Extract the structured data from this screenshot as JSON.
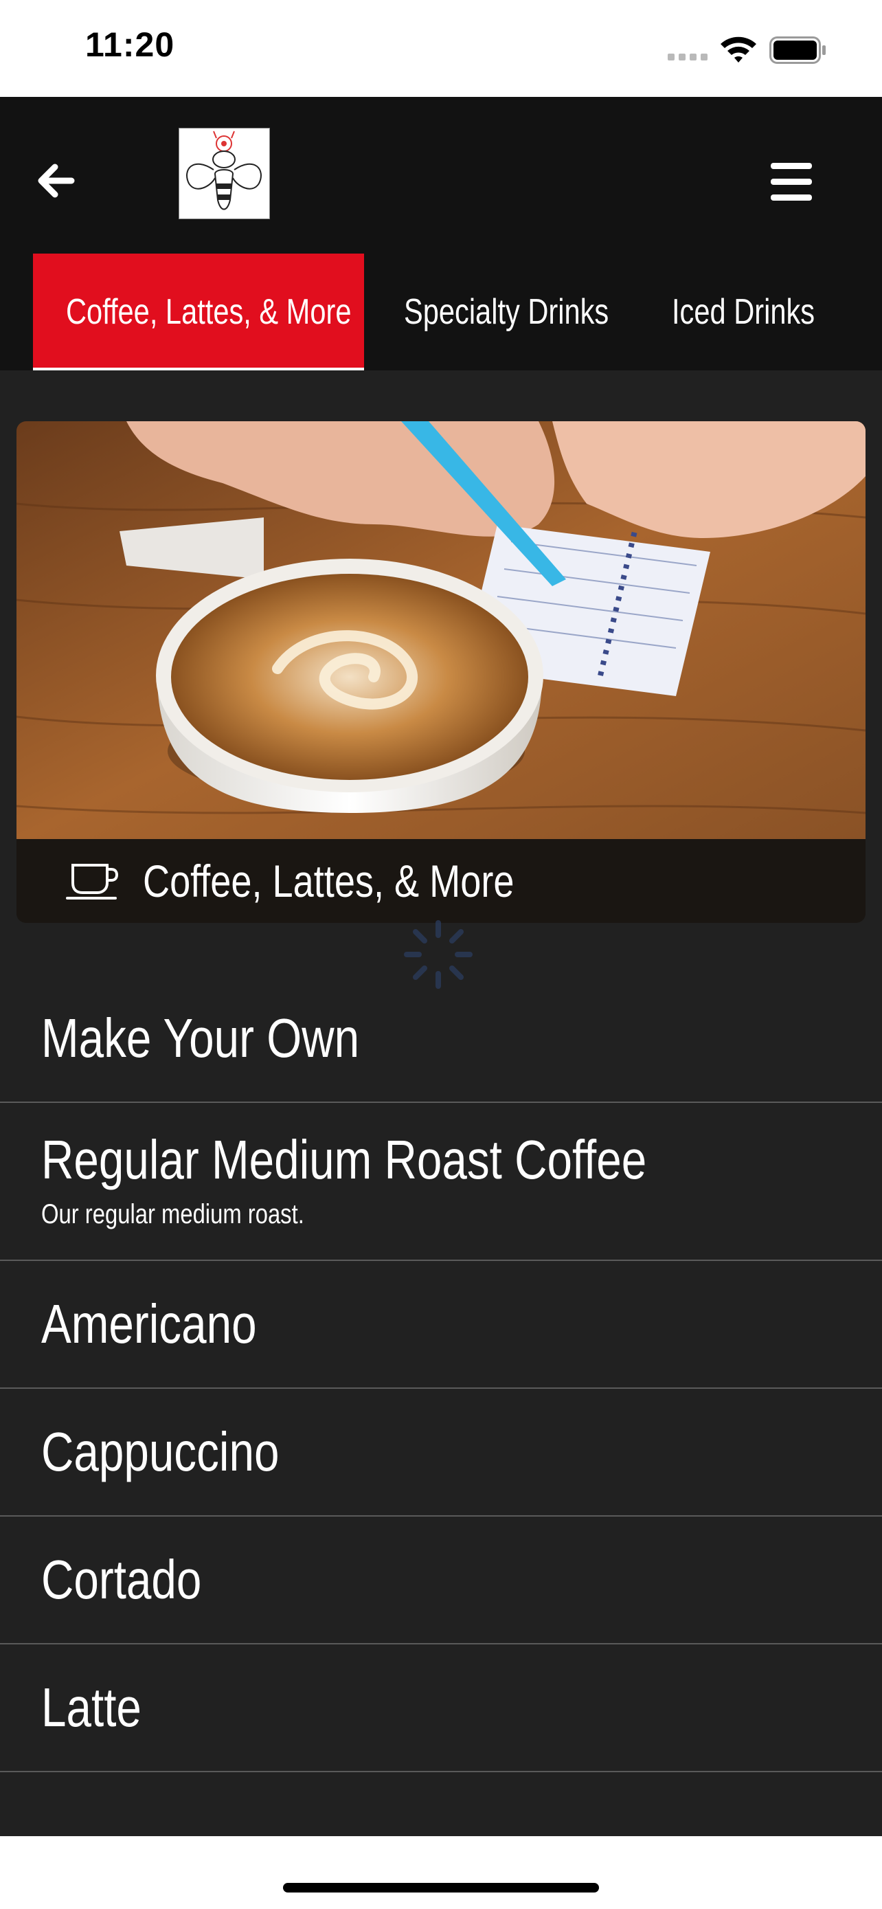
{
  "status_bar": {
    "time": "11:20"
  },
  "header": {
    "back_icon": "arrow-left-icon",
    "logo": "bee-logo",
    "menu_icon": "hamburger-menu-icon"
  },
  "tabs": [
    {
      "label": "Coffee, Lattes, & More",
      "active": true
    },
    {
      "label": "Specialty Drinks",
      "active": false
    },
    {
      "label": "Iced Drinks",
      "active": false
    }
  ],
  "category_card": {
    "icon": "coffee-cup-icon",
    "title": "Coffee, Lattes, & More"
  },
  "menu_items": [
    {
      "name": "Make Your Own"
    },
    {
      "name": "Regular Medium Roast Coffee",
      "description": "Our regular medium roast."
    },
    {
      "name": "Americano"
    },
    {
      "name": "Cappuccino"
    },
    {
      "name": "Cortado"
    },
    {
      "name": "Latte"
    }
  ],
  "colors": {
    "accent": "#e10e1e",
    "header_bg": "#121212",
    "content_bg": "#212121",
    "divider": "#5a5a5a"
  }
}
